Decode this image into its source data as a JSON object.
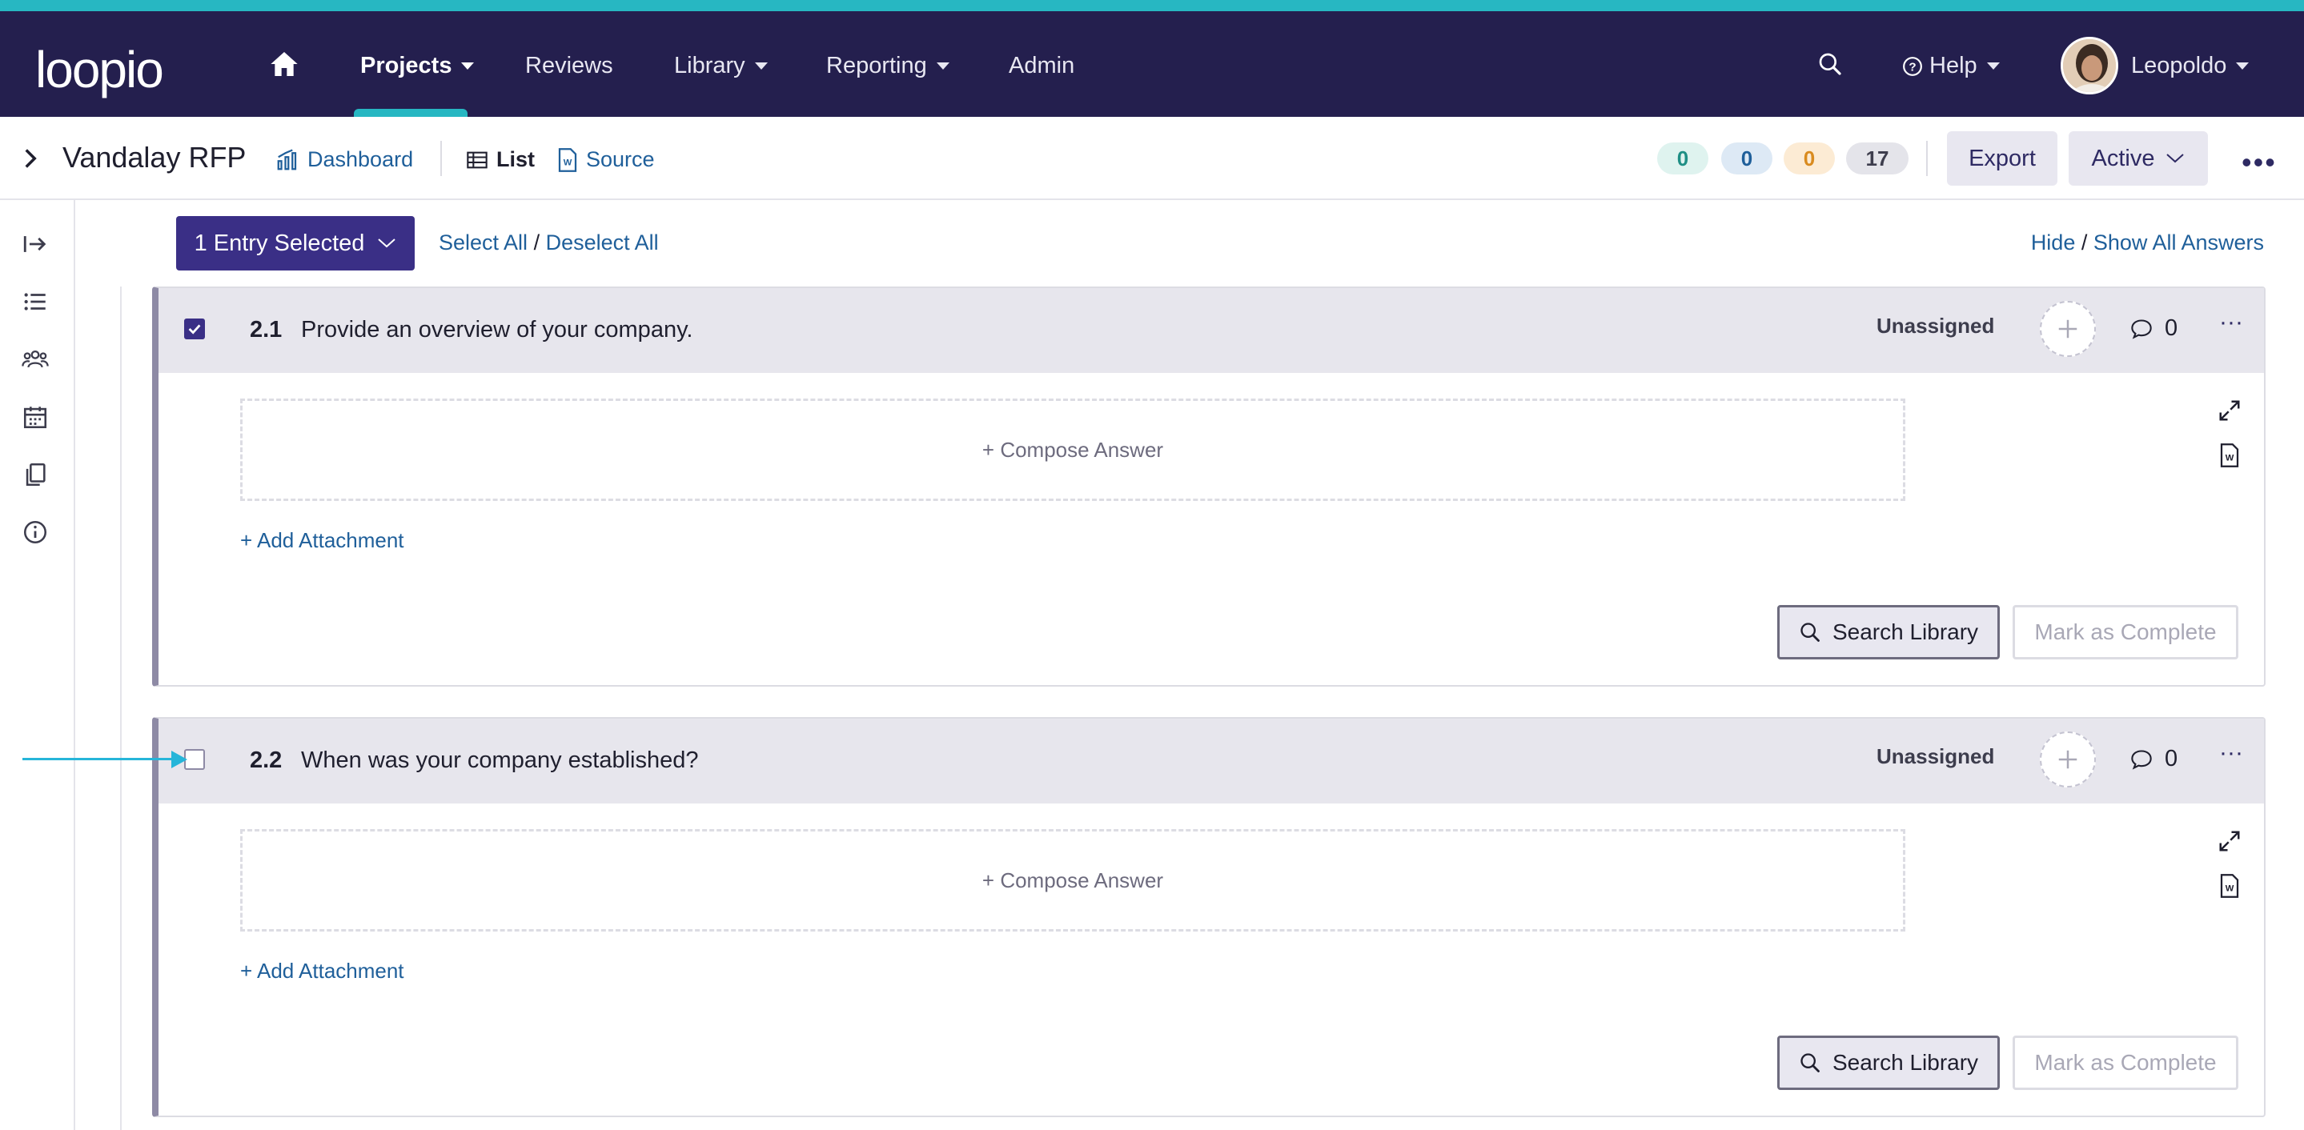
{
  "app": {
    "logo_text": "loopio",
    "accent_color": "#27b7c2",
    "nav_bg": "#241f4e"
  },
  "nav": {
    "items": [
      {
        "label": "Projects"
      },
      {
        "label": "Reviews"
      },
      {
        "label": "Library"
      },
      {
        "label": "Reporting"
      },
      {
        "label": "Admin"
      }
    ],
    "help_label": "Help",
    "user_name": "Leopoldo"
  },
  "project": {
    "title": "Vandalay RFP",
    "views": {
      "dashboard": "Dashboard",
      "list": "List",
      "source": "Source"
    },
    "status_counts": [
      {
        "value": "0",
        "color": "#1f8f85",
        "bg": "#dff3ef"
      },
      {
        "value": "0",
        "color": "#1f5f9a",
        "bg": "#dde9f5"
      },
      {
        "value": "0",
        "color": "#d98b1f",
        "bg": "#fcebd4"
      },
      {
        "value": "17",
        "color": "#3d3d4d",
        "bg": "#e4e4ea"
      }
    ],
    "export_label": "Export",
    "status_label": "Active"
  },
  "selection": {
    "entry_button": "1 Entry Selected",
    "select_all": "Select All",
    "separator": "/",
    "deselect_all": "Deselect All",
    "hide": "Hide",
    "show_all_answers": "Show All Answers"
  },
  "entries": [
    {
      "number": "2.1",
      "question": "Provide an overview of your company.",
      "assignee": "Unassigned",
      "comments": "0",
      "checked": true,
      "compose_label": "+ Compose Answer",
      "attachment_label": "+ Add Attachment",
      "search_library": "Search Library",
      "mark_complete": "Mark as Complete"
    },
    {
      "number": "2.2",
      "question": "When was your company established?",
      "assignee": "Unassigned",
      "comments": "0",
      "checked": false,
      "compose_label": "+ Compose Answer",
      "attachment_label": "+ Add Attachment",
      "search_library": "Search Library",
      "mark_complete": "Mark as Complete"
    }
  ]
}
